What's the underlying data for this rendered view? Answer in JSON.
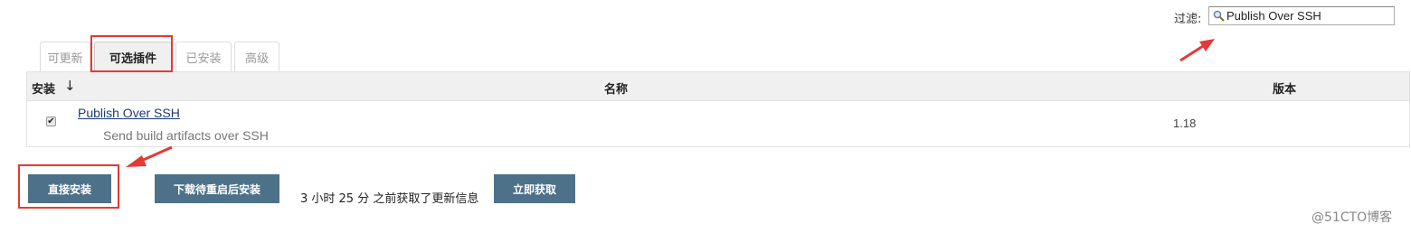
{
  "filter": {
    "label": "过滤:",
    "value": "Publish Over SSH"
  },
  "tabs": [
    {
      "label": "可更新"
    },
    {
      "label": "可选插件"
    },
    {
      "label": "已安装"
    },
    {
      "label": "高级"
    }
  ],
  "table": {
    "headers": {
      "install": "安装",
      "sort_arrow": "↓",
      "name": "名称",
      "version": "版本"
    },
    "rows": [
      {
        "checked": true,
        "check_glyph": "✔",
        "name": "Publish Over SSH",
        "description": "Send build artifacts over SSH",
        "version": "1.18"
      }
    ]
  },
  "actions": {
    "install_now": "直接安装",
    "download_restart": "下载待重启后安装",
    "status": "3 小时 25 分 之前获取了更新信息",
    "check_now": "立即获取"
  },
  "watermark": "@51CTO博客",
  "colors": {
    "button": "#4d7189",
    "annotation": "#e53935",
    "link": "#1b3a7a"
  }
}
